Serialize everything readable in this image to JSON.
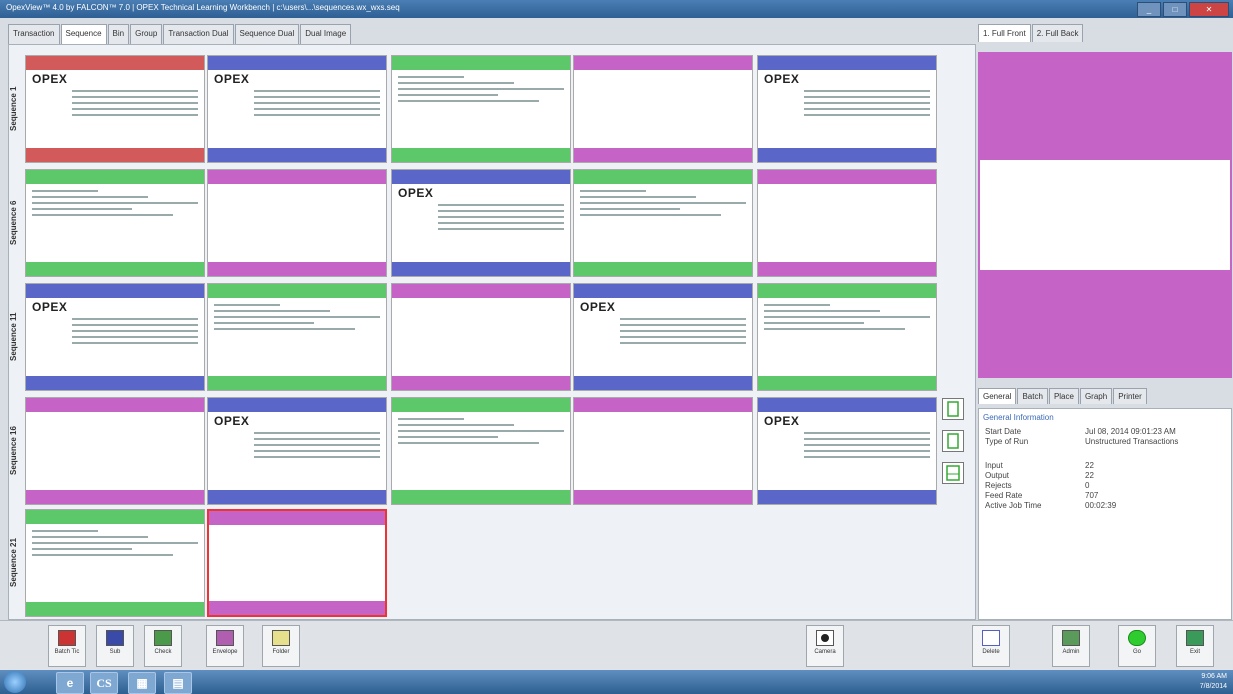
{
  "window": {
    "title": "OpexView™ 4.0 by FALCON™ 7.0 | OPEX Technical Learning Workbench | c:\\users\\...\\sequences.wx_wxs.seq",
    "buttons": [
      "_",
      "□",
      "✕"
    ]
  },
  "tabs": [
    "Transaction",
    "Sequence",
    "Bin",
    "Group",
    "Transaction Dual",
    "Sequence Dual",
    "Dual Image"
  ],
  "active_tab": "Sequence",
  "sequences": [
    "Sequence 1",
    "Sequence 6",
    "Sequence 11",
    "Sequence 16",
    "Sequence 21"
  ],
  "tile_brand": "OPEX",
  "colors": {
    "green": "#5cc86a",
    "purple": "#c564c6",
    "red": "#d25a5a",
    "blue": "#5b66c9",
    "selected": "#e33333"
  },
  "right_tabs": [
    "1. Full Front",
    "2. Full Back"
  ],
  "info_tabs": [
    "General",
    "Batch",
    "Place",
    "Graph",
    "Printer"
  ],
  "info": {
    "section": "General Information",
    "rows": [
      {
        "label": "Start Date",
        "value": "Jul 08, 2014 09:01:23 AM"
      },
      {
        "label": "Type of Run",
        "value": "Unstructured Transactions"
      },
      {
        "label": "Input",
        "value": "22"
      },
      {
        "label": "Output",
        "value": "22"
      },
      {
        "label": "Rejects",
        "value": "0"
      },
      {
        "label": "Feed Rate",
        "value": "707"
      },
      {
        "label": "Active Job Time",
        "value": "00:02:39"
      }
    ]
  },
  "toolbar_left": [
    {
      "label": "Batch Tic",
      "icon": "batch-ticket-icon"
    },
    {
      "label": "Sub",
      "icon": "sub-icon"
    },
    {
      "label": "Check",
      "icon": "check-icon"
    },
    {
      "label": "Envelope",
      "icon": "envelope-icon"
    },
    {
      "label": "Folder",
      "icon": "folder-icon"
    }
  ],
  "toolbar_mid": {
    "label": "Camera",
    "icon": "camera-icon"
  },
  "toolbar_right": [
    {
      "label": "Delete",
      "icon": "delete-icon"
    },
    {
      "label": "Admin",
      "icon": "admin-icon"
    },
    {
      "label": "Go",
      "icon": "go-icon"
    },
    {
      "label": "Exit",
      "icon": "exit-icon"
    }
  ],
  "taskbar": {
    "apps": [
      "e",
      "CS",
      "▦",
      "▤"
    ],
    "time": "9:06 AM",
    "date": "7/8/2014"
  }
}
